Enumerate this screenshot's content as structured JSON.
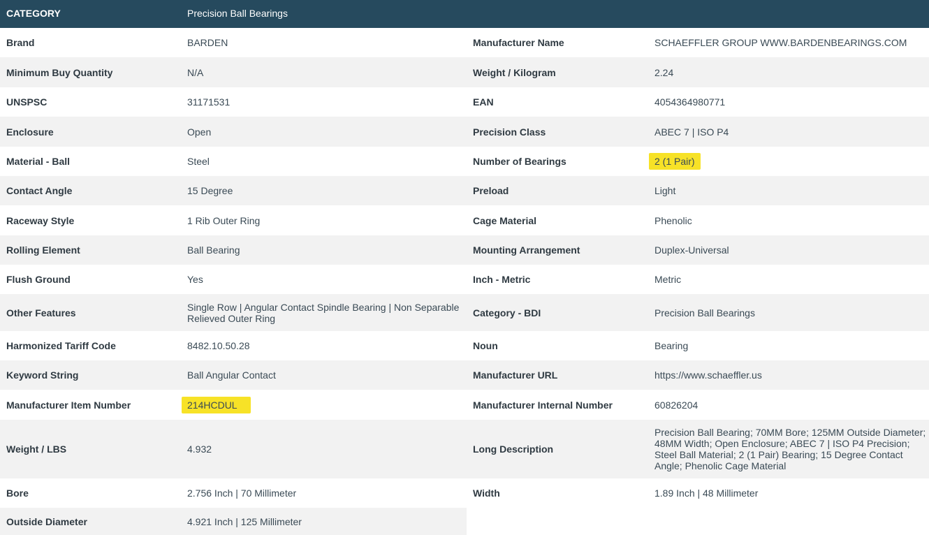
{
  "header": {
    "key": "CATEGORY",
    "value": "Precision Ball Bearings"
  },
  "rows": [
    {
      "k1": "Brand",
      "v1": "BARDEN",
      "k2": "Manufacturer Name",
      "v2": "SCHAEFFLER GROUP WWW.BARDENBEARINGS.COM"
    },
    {
      "k1": "Minimum Buy Quantity",
      "v1": "N/A",
      "k2": "Weight / Kilogram",
      "v2": "2.24"
    },
    {
      "k1": "UNSPSC",
      "v1": "31171531",
      "k2": "EAN",
      "v2": "4054364980771"
    },
    {
      "k1": "Enclosure",
      "v1": "Open",
      "k2": "Precision Class",
      "v2": "ABEC 7 | ISO P4"
    },
    {
      "k1": "Material - Ball",
      "v1": "Steel",
      "k2": "Number of Bearings",
      "v2": "2 (1 Pair)"
    },
    {
      "k1": "Contact Angle",
      "v1": "15 Degree",
      "k2": "Preload",
      "v2": "Light"
    },
    {
      "k1": "Raceway Style",
      "v1": "1 Rib Outer Ring",
      "k2": "Cage Material",
      "v2": "Phenolic"
    },
    {
      "k1": "Rolling Element",
      "v1": "Ball Bearing",
      "k2": "Mounting Arrangement",
      "v2": "Duplex-Universal"
    },
    {
      "k1": "Flush Ground",
      "v1": "Yes",
      "k2": "Inch - Metric",
      "v2": "Metric"
    },
    {
      "k1": "Other Features",
      "v1": "Single Row | Angular Contact Spindle Bearing | Non Separable Relieved Outer Ring",
      "k2": "Category - BDI",
      "v2": "Precision Ball Bearings"
    },
    {
      "k1": "Harmonized Tariff Code",
      "v1": "8482.10.50.28",
      "k2": "Noun",
      "v2": "Bearing"
    },
    {
      "k1": "Keyword String",
      "v1": "Ball Angular Contact",
      "k2": "Manufacturer URL",
      "v2": "https://www.schaeffler.us"
    },
    {
      "k1": "Manufacturer Item Number",
      "v1": "214HCDUL",
      "k2": "Manufacturer Internal Number",
      "v2": "60826204"
    },
    {
      "k1": "Weight / LBS",
      "v1": "4.932",
      "k2": "Long Description",
      "v2": "Precision Ball Bearing; 70MM Bore; 125MM Outside Diameter; 48MM Width; Open Enclosure; ABEC 7 | ISO P4 Precision; Steel Ball Material; 2 (1 Pair) Bearing; 15 Degree Contact Angle; Phenolic Cage Material"
    },
    {
      "k1": "Bore",
      "v1": "2.756 Inch | 70 Millimeter",
      "k2": "Width",
      "v2": "1.89 Inch | 48 Millimeter"
    },
    {
      "k1": "Outside Diameter",
      "v1": "4.921 Inch | 125 Millimeter"
    }
  ],
  "colors": {
    "header_bg": "#264a5e",
    "stripe": "#f2f2f2",
    "highlight": "#f7e227"
  }
}
